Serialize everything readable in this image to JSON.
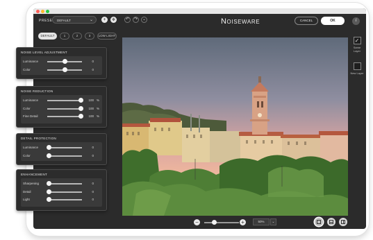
{
  "toolbar": {
    "preset_label": "PRESET",
    "preset_value": "DEFAULT",
    "add_icon": "plus-icon",
    "settings_icon": "gear-icon",
    "undo_icon": "undo-icon",
    "redo_icon": "redo-icon",
    "history_icon": "chevron-down-icon",
    "app_title": "Noiseware",
    "cancel_label": "CANCEL",
    "ok_label": "OK",
    "info_icon": "info-icon"
  },
  "preset_tabs": [
    "DEFAULT",
    "1",
    "2",
    "3",
    "LOW LIGHT"
  ],
  "panels": {
    "noise_level": {
      "title": "NOISE LEVEL ADJUSTMENT",
      "rows": [
        {
          "label": "Luminance",
          "value": "0",
          "unit": "",
          "level": 0.5
        },
        {
          "label": "Color",
          "value": "0",
          "unit": "",
          "level": 0.5
        }
      ]
    },
    "noise_reduction": {
      "title": "NOISE REDUCTION",
      "rows": [
        {
          "label": "Luminance",
          "value": "100",
          "unit": "%",
          "level": 1.0
        },
        {
          "label": "Color",
          "value": "100",
          "unit": "%",
          "level": 1.0
        },
        {
          "label": "Fine Detail",
          "value": "100",
          "unit": "%",
          "level": 1.0
        }
      ]
    },
    "detail_protection": {
      "title": "DETAIL PROTECTION",
      "rows": [
        {
          "label": "Luminance",
          "value": "0",
          "unit": "",
          "level": 0.0
        },
        {
          "label": "Color",
          "value": "0",
          "unit": "",
          "level": 0.0
        }
      ]
    },
    "enhancement": {
      "title": "ENHANCEMENT",
      "rows": [
        {
          "label": "Sharpening",
          "value": "0",
          "unit": "",
          "level": 0.0
        },
        {
          "label": "Detail",
          "value": "0",
          "unit": "",
          "level": 0.0
        },
        {
          "label": "Light",
          "value": "0",
          "unit": "",
          "level": 0.0
        }
      ]
    }
  },
  "layer_options": {
    "same_layer": "Same Layer",
    "new_layer": "New Layer",
    "same_layer_checked": true
  },
  "bottom": {
    "zoom_value": "50%",
    "zoom_level": 0.25,
    "view_modes": [
      "single-view-icon",
      "split-horizontal-icon",
      "split-vertical-icon"
    ],
    "active_view": 0
  },
  "colors": {
    "app_bg": "#2b2b2b",
    "panel_bg": "#2c2c2c",
    "ok_bg": "#ffffff"
  }
}
